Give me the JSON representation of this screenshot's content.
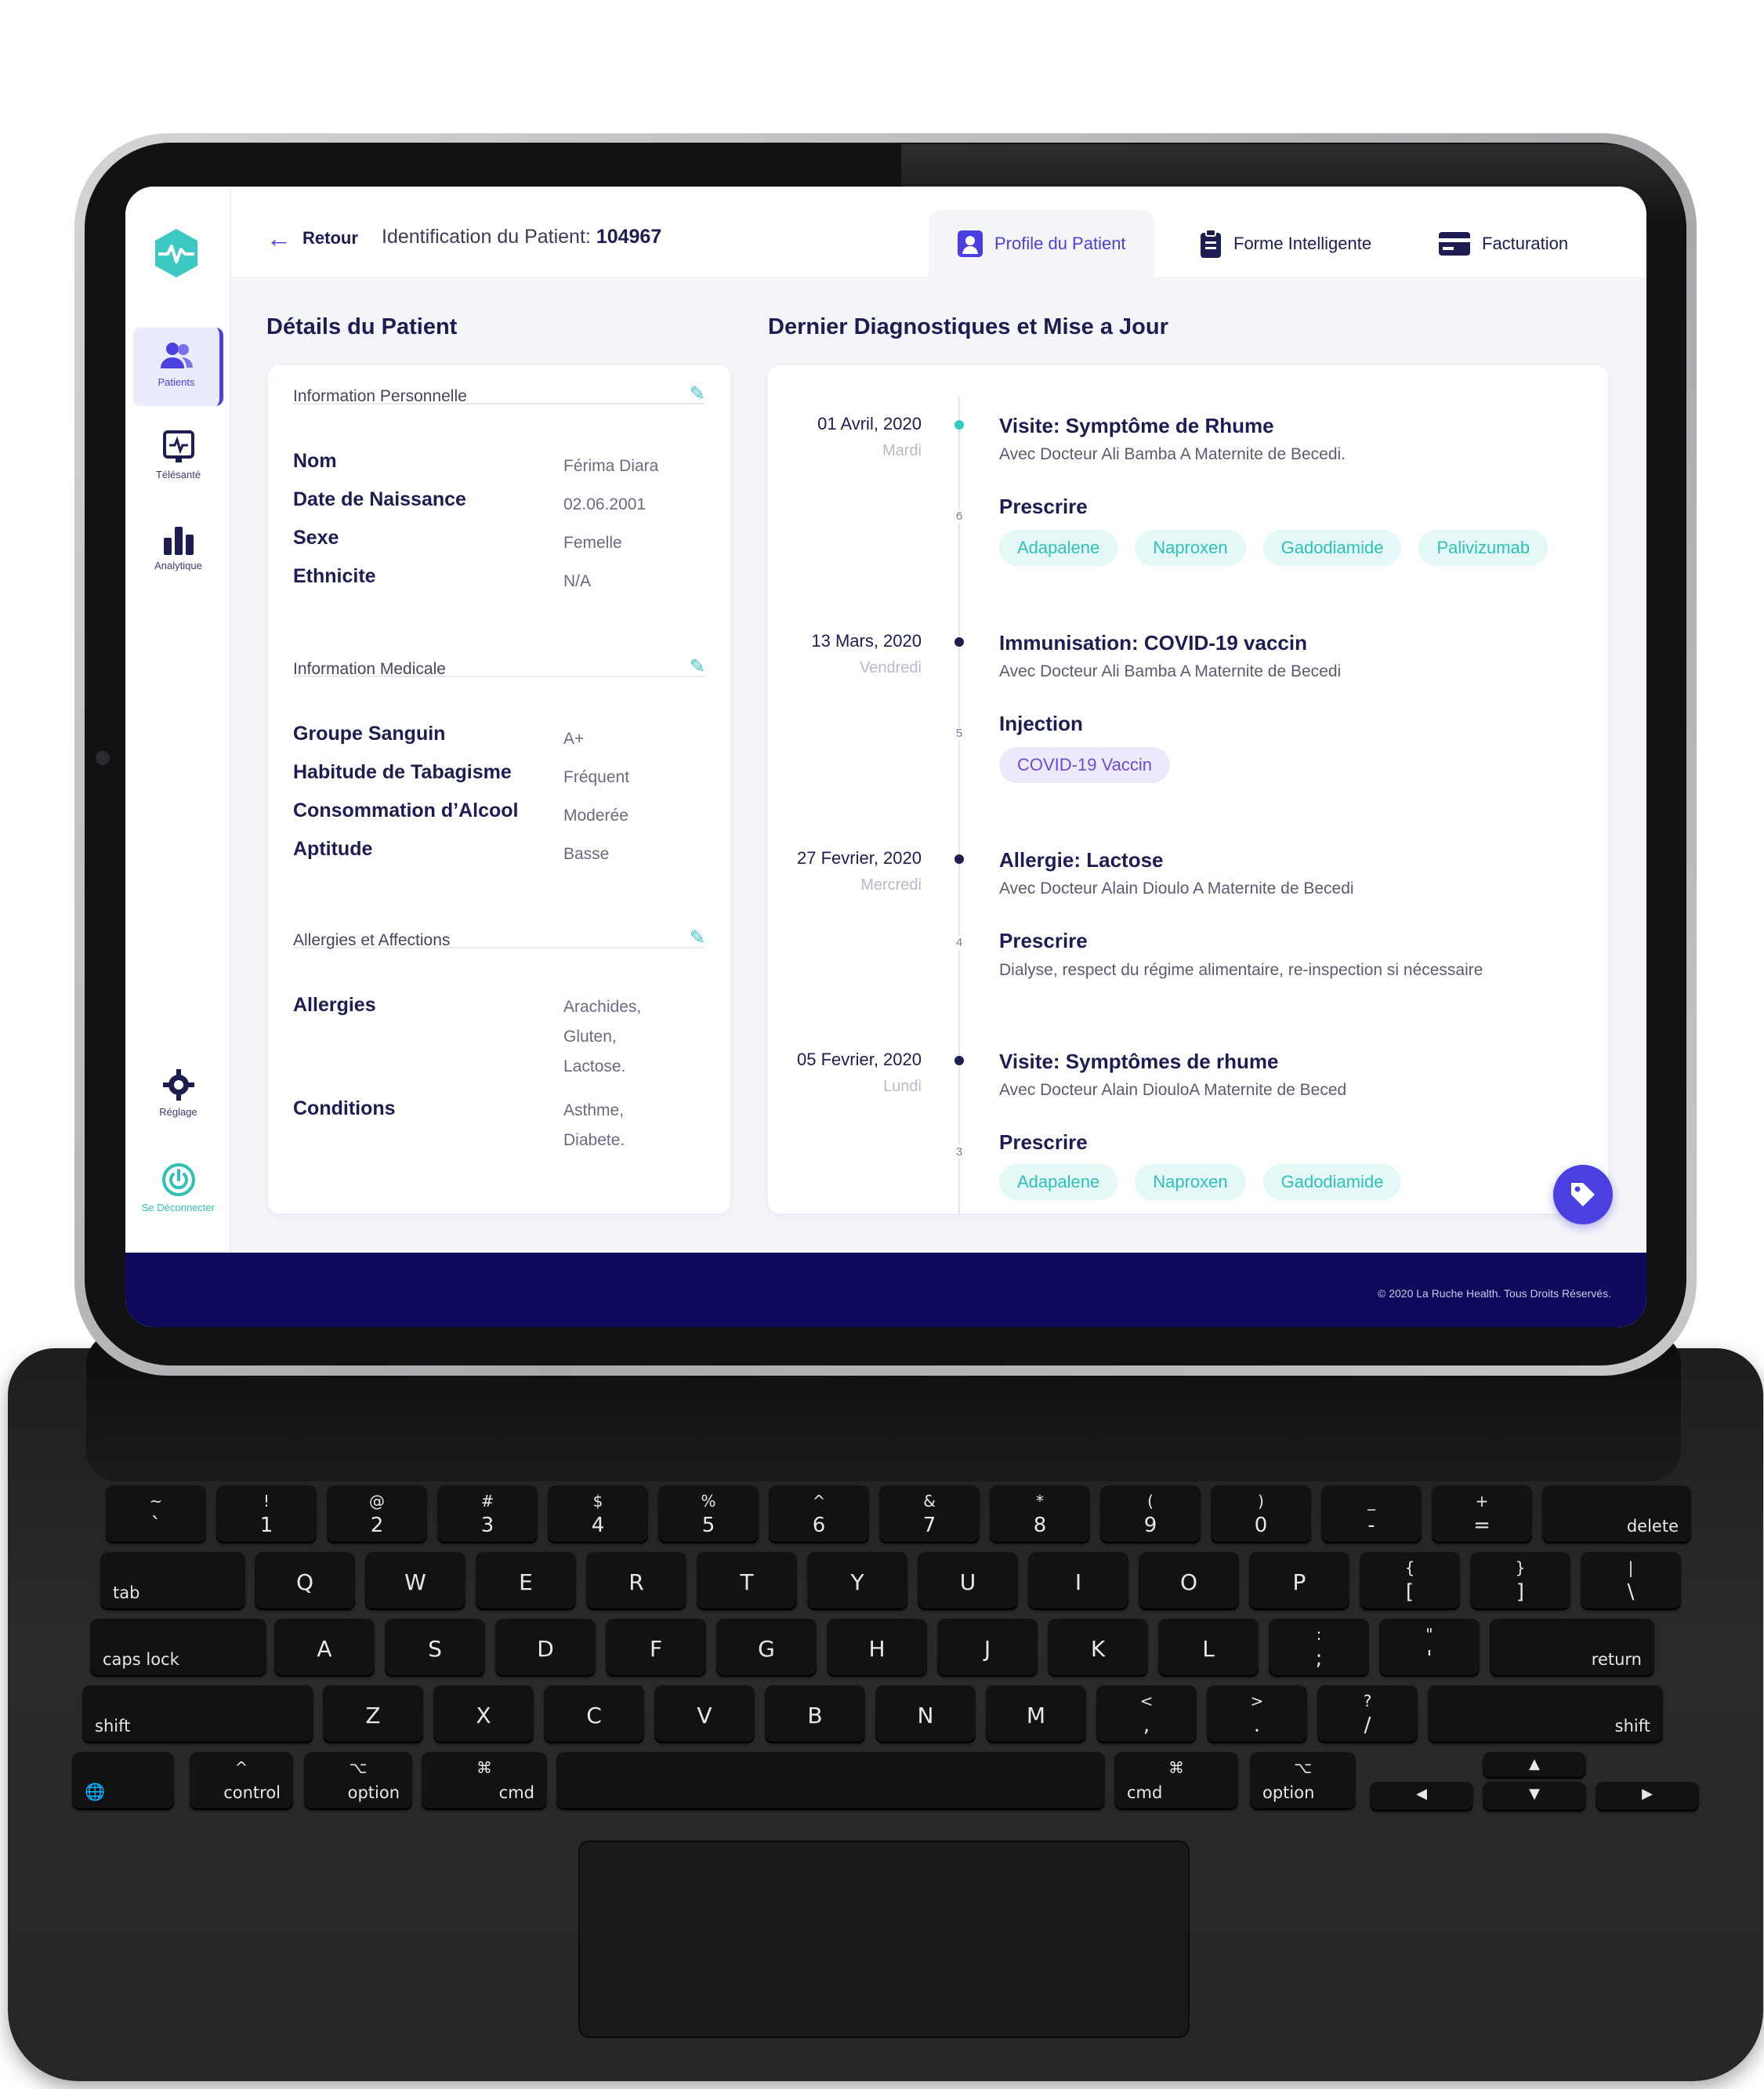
{
  "topbar": {
    "back_label": "Retour",
    "patient_id_label": "Identification du Patient:",
    "patient_id": "104967",
    "tabs": [
      {
        "label": "Profile du Patient",
        "icon": "user-badge-icon",
        "active": true
      },
      {
        "label": "Forme Intelligente",
        "icon": "clipboard-icon",
        "active": false
      },
      {
        "label": "Facturation",
        "icon": "credit-card-icon",
        "active": false
      }
    ]
  },
  "sidebar": {
    "items": [
      {
        "label": "Patients",
        "icon": "users-icon",
        "active": true
      },
      {
        "label": "Télésanté",
        "icon": "telehealth-monitor-icon",
        "active": false
      },
      {
        "label": "Analytique",
        "icon": "bar-chart-icon",
        "active": false
      }
    ],
    "settings_label": "Réglage",
    "logout_label": "Se Déconnecter"
  },
  "details": {
    "title": "Détails du Patient",
    "personal": {
      "heading": "Information Personnelle",
      "rows": [
        {
          "k": "Nom",
          "v": "Férima Diara"
        },
        {
          "k": "Date de Naissance",
          "v": "02.06.2001"
        },
        {
          "k": "Sexe",
          "v": "Femelle"
        },
        {
          "k": "Ethnicite",
          "v": "N/A"
        }
      ]
    },
    "medical": {
      "heading": "Information Medicale",
      "rows": [
        {
          "k": "Groupe Sanguin",
          "v": "A+"
        },
        {
          "k": "Habitude de Tabagisme",
          "v": "Fréquent"
        },
        {
          "k": "Consommation d’Alcool",
          "v": "Moderée"
        },
        {
          "k": "Aptitude",
          "v": "Basse"
        }
      ]
    },
    "allergies": {
      "heading": "Allergies et Affections",
      "rows": [
        {
          "k": "Allergies",
          "v1": "Arachides,",
          "v2": "Gluten,",
          "v3": "Lactose."
        },
        {
          "k": "Conditions",
          "v1": "Asthme,",
          "v2": "Diabete."
        }
      ]
    }
  },
  "timeline": {
    "title": "Dernier Diagnostiques et Mise a Jour",
    "entries": [
      {
        "date": "01 Avril, 2020",
        "day": "Mardi",
        "num": "6",
        "title": "Visite: Symptôme de Rhume",
        "sub": "Avec Docteur Ali Bamba A Maternite de Becedi.",
        "label": "Prescrire",
        "chips": [
          "Adapalene",
          "Naproxen",
          "Gadodiamide",
          "Palivizumab"
        ]
      },
      {
        "date": "13 Mars, 2020",
        "day": "Vendredi",
        "num": "5",
        "title": "Immunisation: COVID-19 vaccin",
        "sub": "Avec Docteur Ali Bamba A Maternite de Becedi",
        "label": "Injection",
        "chips": [
          "COVID-19 Vaccin"
        ]
      },
      {
        "date": "27 Fevrier, 2020",
        "day": "Mercredi",
        "num": "4",
        "title": "Allergie: Lactose",
        "sub": "Avec Docteur Alain Dioulo A Maternite de Becedi",
        "label": "Prescrire",
        "text": "Dialyse, respect du régime alimentaire, re-inspection si nécessaire"
      },
      {
        "date": "05 Fevrier, 2020",
        "day": "Lundi",
        "num": "3",
        "title": "Visite: Symptômes de rhume",
        "sub": "Avec Docteur Alain DiouloA Maternite de Beced",
        "label": "Prescrire",
        "chips": [
          "Adapalene",
          "Naproxen",
          "Gadodiamide"
        ]
      }
    ]
  },
  "footer": {
    "copyright": "© 2020 La Ruche Health. Tous Droits Réservés."
  },
  "colors": {
    "accent": "#4b3fe0",
    "teal": "#2fc1b8",
    "navy": "#1d1d52",
    "footer": "#0d0a5c"
  },
  "keyboard": {
    "row1": [
      [
        "~",
        "`"
      ],
      [
        "!",
        "1"
      ],
      [
        "@",
        "2"
      ],
      [
        "#",
        "3"
      ],
      [
        "$",
        "4"
      ],
      [
        "%",
        "5"
      ],
      [
        "^",
        "6"
      ],
      [
        "&",
        "7"
      ],
      [
        "*",
        "8"
      ],
      [
        "(",
        "9"
      ],
      [
        ")",
        "0"
      ],
      [
        "_",
        "-"
      ],
      [
        "+",
        "="
      ]
    ],
    "delete": "delete",
    "row2": [
      "Q",
      "W",
      "E",
      "R",
      "T",
      "Y",
      "U",
      "I",
      "O",
      "P"
    ],
    "row2_sym": [
      [
        "{",
        "["
      ],
      [
        "}",
        "]"
      ],
      [
        "|",
        "\\"
      ]
    ],
    "tab": "tab",
    "row3": [
      "A",
      "S",
      "D",
      "F",
      "G",
      "H",
      "J",
      "K",
      "L"
    ],
    "row3_sym": [
      [
        ":",
        ";"
      ],
      [
        "\"",
        "'"
      ]
    ],
    "caps": "caps lock",
    "return": "return",
    "row4": [
      "Z",
      "X",
      "C",
      "V",
      "B",
      "N",
      "M"
    ],
    "row4_sym": [
      [
        "<",
        ","
      ],
      [
        ">",
        "."
      ],
      [
        "?",
        "/"
      ]
    ],
    "shift": "shift",
    "control": "control",
    "option": "option",
    "cmd": "cmd",
    "cmd_symbol": "⌘",
    "option_symbol": "⌥",
    "control_symbol": "^",
    "globe_symbol": "🌐",
    "arrow_left": "◀",
    "arrow_right": "▶",
    "arrow_up": "▲",
    "arrow_down": "▼"
  }
}
